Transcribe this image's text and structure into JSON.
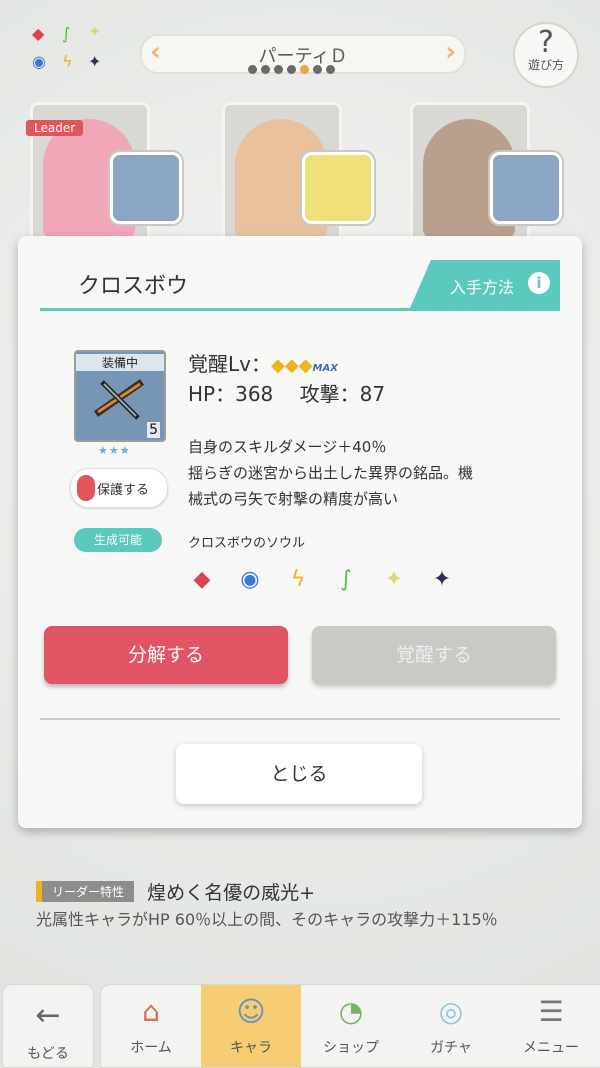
{
  "header": {
    "party_name": "パーティＤ",
    "prev_icon": "chevron-left-icon",
    "next_icon": "chevron-right-icon",
    "page_count": 7,
    "active_page": 5,
    "help_label": "遊び方",
    "help_glyph": "?"
  },
  "party": {
    "leader_label": "Leader"
  },
  "modal": {
    "title": "クロスボウ",
    "how_to_obtain": "入手方法",
    "info_glyph": "i",
    "item": {
      "equipped_label": "装備中",
      "count": "5",
      "stars": "★★★"
    },
    "protect_label": "保護する",
    "awaken_label": "覚醒Lv：",
    "awaken_gems": "◆◆◆",
    "awaken_max": "MAX",
    "hp_label": "HP：368",
    "atk_label": "攻撃：87",
    "description_line1": "自身のスキルダメージ＋40％",
    "description_line2": "揺らぎの迷宮から出土した異界の銘品。機",
    "description_line3": "械式の弓矢で射撃の精度が高い",
    "craftable_label": "生成可能",
    "soul_label": "クロスボウのソウル",
    "souls": [
      {
        "icon": "fire-element-icon",
        "glyph": "◆",
        "color": "#d9434f"
      },
      {
        "icon": "water-element-icon",
        "glyph": "◉",
        "color": "#3b78d8"
      },
      {
        "icon": "lightning-element-icon",
        "glyph": "ϟ",
        "color": "#f2b21b"
      },
      {
        "icon": "wind-element-icon",
        "glyph": "∫",
        "color": "#58b948"
      },
      {
        "icon": "light-element-icon",
        "glyph": "✦",
        "color": "#d9d97a"
      },
      {
        "icon": "dark-element-icon",
        "glyph": "✦",
        "color": "#3a2a50"
      }
    ],
    "dismantle_label": "分解する",
    "awaken_button_label": "覚醒する",
    "close_label": "とじる"
  },
  "leader_skill": {
    "tag": "リーダー特性",
    "name": "煌めく名優の威光+",
    "description": "光属性キャラがHP 60％以上の間、そのキャラの攻撃力＋115％"
  },
  "nav": {
    "back_label": "もどる",
    "items": [
      {
        "label": "ホーム",
        "icon": "home-icon",
        "glyph": "⌂",
        "active": false
      },
      {
        "label": "キャラ",
        "icon": "character-icon",
        "glyph": "☺",
        "active": true
      },
      {
        "label": "ショップ",
        "icon": "shop-icon",
        "glyph": "◔",
        "active": false
      },
      {
        "label": "ガチャ",
        "icon": "gacha-icon",
        "glyph": "◎",
        "active": false
      },
      {
        "label": "メニュー",
        "icon": "menu-icon",
        "glyph": "☰",
        "active": false
      }
    ]
  },
  "colors": {
    "accent": "#5bc9bd",
    "danger": "#e05463",
    "active_tab": "#f6cd73"
  }
}
